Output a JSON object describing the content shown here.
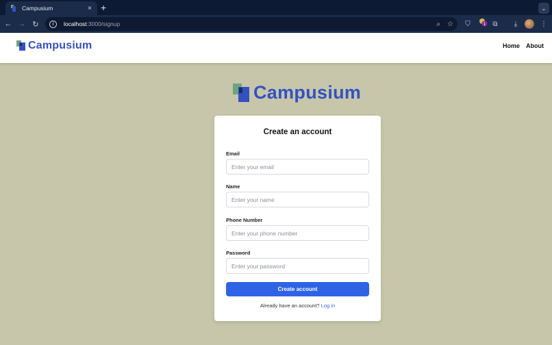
{
  "browser": {
    "tab_title": "Campusium",
    "tab_close": "×",
    "new_tab": "+",
    "tab_menu": "⌄",
    "url_host": "localhost",
    "url_path": ":3000/signup",
    "nav_back": "←",
    "nav_forward": "→",
    "nav_reload": "↻",
    "info_glyph": "i",
    "zoom_glyph": "⌕",
    "star_glyph": "☆",
    "bookmark_glyph": "⛉",
    "extensions_glyph": "⧉",
    "download_glyph": "⤓",
    "menu_glyph": "⋮",
    "extension_badge": "1"
  },
  "icons": {
    "info": "info-icon",
    "zoom": "zoom-icon",
    "star": "star-icon",
    "bookmark": "bookmark-icon",
    "extensions": "puzzle-icon",
    "download": "download-icon",
    "menu": "kebab-menu-icon"
  },
  "header": {
    "brand": "Campusium",
    "nav": [
      "Home",
      "About"
    ]
  },
  "hero": {
    "brand": "Campusium"
  },
  "signup": {
    "title": "Create an account",
    "fields": [
      {
        "label": "Email",
        "placeholder": "Enter your email",
        "value": ""
      },
      {
        "label": "Name",
        "placeholder": "Enter your name",
        "value": ""
      },
      {
        "label": "Phone Number",
        "placeholder": "Enter your phone number",
        "value": ""
      },
      {
        "label": "Password",
        "placeholder": "Enter your password",
        "value": ""
      }
    ],
    "submit_label": "Create account",
    "login_prompt": "Already have an account?",
    "login_link": "Log in"
  },
  "colors": {
    "page_background": "#c7c6aa",
    "brand_blue": "#3352c2",
    "button_blue": "#2f63e6",
    "chrome_dark": "#0c1a33",
    "logo_green": "#6fa37c"
  }
}
